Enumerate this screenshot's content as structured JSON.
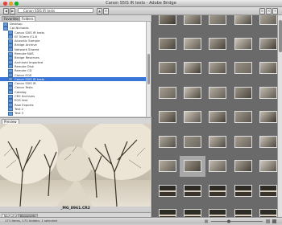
{
  "window": {
    "title": "Canon S5IS IR tests - Adobe Bridge",
    "close_color": "#e0443e",
    "minimize_color": "#dea123",
    "zoom_color": "#1aab29"
  },
  "toolbar": {
    "back_icon": "arrow-left-icon",
    "forward_icon": "arrow-right-icon",
    "path": "Canon S5IS IR tests"
  },
  "left_tabs": [
    "Favorites",
    "Folders"
  ],
  "folders": [
    {
      "label": "Desktop",
      "selected": false
    },
    {
      "label": "Cpl-Nicholas",
      "selected": false
    },
    {
      "label": "Canon S5IS IR tests",
      "selected": false
    },
    {
      "label": "EF 50mm f/1.8",
      "selected": false
    },
    {
      "label": "Acoustic Sample",
      "selected": false
    },
    {
      "label": "Bridge Archive",
      "selected": false
    },
    {
      "label": "Network Shared",
      "selected": false
    },
    {
      "label": "Remote NAS",
      "selected": false
    },
    {
      "label": "Bridge Reserves",
      "selected": false
    },
    {
      "label": "Archived Imported",
      "selected": false
    },
    {
      "label": "Remote Disk",
      "selected": false
    },
    {
      "label": "Remote CD",
      "selected": false
    },
    {
      "label": "Canon EOS",
      "selected": false
    },
    {
      "label": "Canon S5IS IR tests",
      "selected": true
    },
    {
      "label": "Canon S5IS IR",
      "selected": false
    },
    {
      "label": "Canon Tests",
      "selected": false
    },
    {
      "label": "Catalog",
      "selected": false
    },
    {
      "label": "CR2 Archives",
      "selected": false
    },
    {
      "label": "EOS test",
      "selected": false
    },
    {
      "label": "Raw Exports",
      "selected": false
    },
    {
      "label": "Test 2",
      "selected": false
    },
    {
      "label": "Test 3",
      "selected": false
    }
  ],
  "preview": {
    "tab_label": "Preview",
    "filename": "_MG_8961.CR2"
  },
  "metadata_tabs": [
    "Metadata",
    "Keywords"
  ],
  "status": {
    "text": "171 items, 171 hidden, 1 selected"
  },
  "thumbnails": {
    "columns": 5,
    "rows": 9,
    "selected_index": 31
  }
}
